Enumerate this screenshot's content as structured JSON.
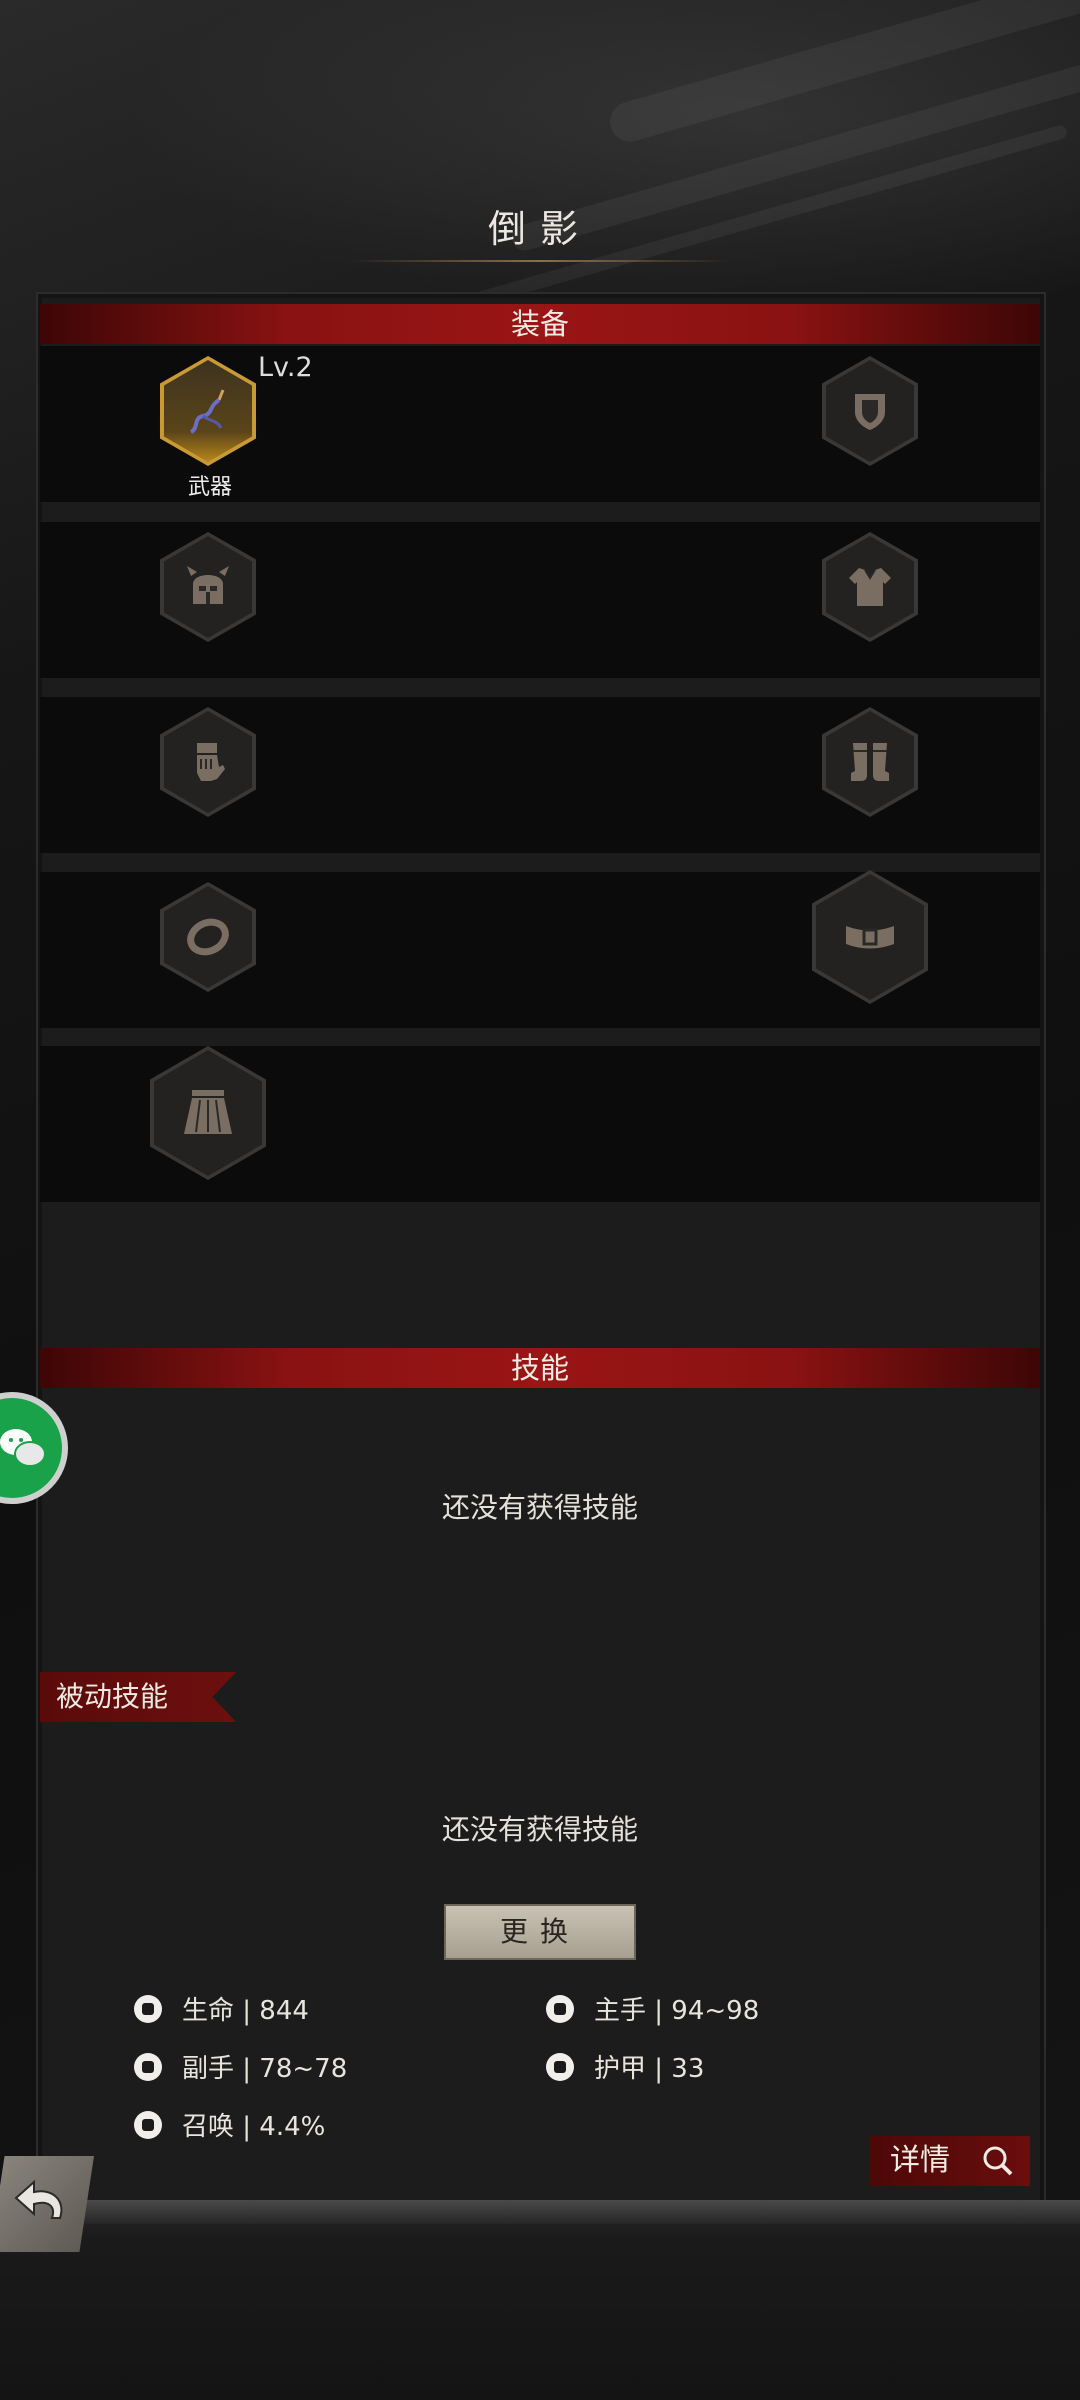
{
  "header": {
    "title": "倒影"
  },
  "equipment": {
    "section_title": "装备",
    "weapon": {
      "level": "Lv.2",
      "label": "武器"
    },
    "slots": [
      "weapon-icon",
      "shield-icon",
      "helmet-icon",
      "chest-armor-icon",
      "gloves-icon",
      "boots-icon",
      "ring-icon",
      "belt-icon",
      "cape-icon"
    ]
  },
  "skills": {
    "section_title": "技能",
    "active_empty": "还没有获得技能",
    "passive_label": "被动技能",
    "passive_empty": "还没有获得技能",
    "change_button": "更换"
  },
  "stats": {
    "life": "生命 | 844",
    "main_hand": "主手 | 94~98",
    "off_hand": "副手 | 78~78",
    "armor": "护甲 | 33",
    "summon": "召唤 | 4.4%"
  },
  "details_button": "详情",
  "colors": {
    "accent_red": "#8a1212",
    "gold": "#c99a34",
    "chat_green": "#1aa24a"
  }
}
